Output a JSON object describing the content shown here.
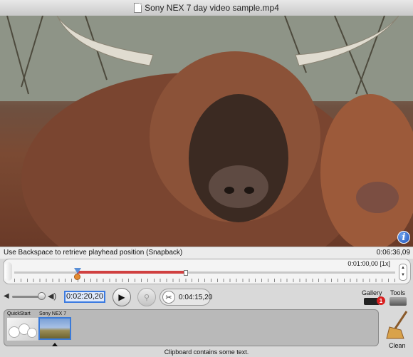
{
  "window": {
    "title": "Sony NEX 7 day video sample.mp4"
  },
  "video": {
    "info_icon": "info-icon",
    "info_glyph": "i"
  },
  "hint": {
    "text": "Use Backspace to retrieve playhead position (Snapback)",
    "total_duration": "0:06:36,09"
  },
  "timeline": {
    "scale": "0:01:00,00",
    "zoom": "[1x]",
    "stepper_up": "▲",
    "stepper_down": "▼"
  },
  "controls": {
    "volume_low_icon": "◀",
    "volume_high_icon": "◀)",
    "current_time": "0:02:20,20",
    "play_glyph": "▶",
    "record_glyph": "⚲",
    "scissors_glyph": "✂",
    "selection_length": "0:04:15,20",
    "gallery_label": "Gallery",
    "gallery_badge": "1",
    "tools_label": "Tools"
  },
  "clipboard": {
    "items": [
      {
        "label": "QuickStart"
      },
      {
        "label": "Sony NEX 7"
      }
    ],
    "clean_label": "Clean"
  },
  "status": {
    "text": "Clipboard contains some text."
  },
  "colors": {
    "accent": "#3b7ae0",
    "selection": "#d04040",
    "badge": "#d82020"
  }
}
